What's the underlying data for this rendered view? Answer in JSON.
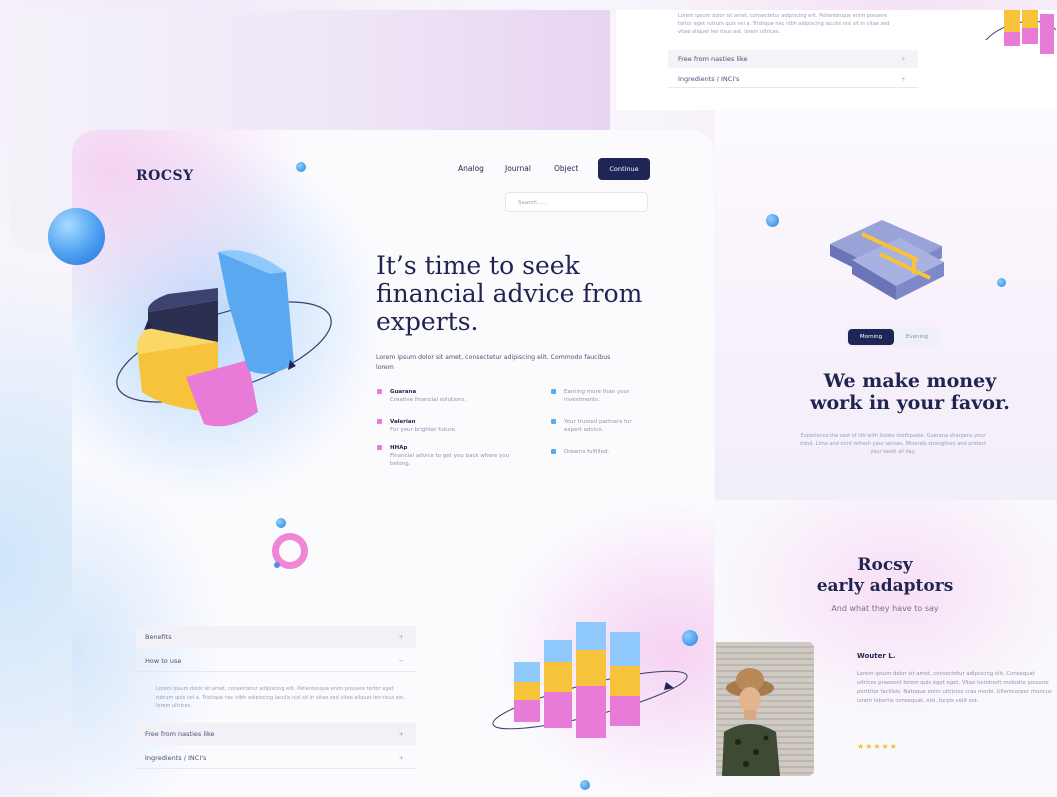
{
  "brand": {
    "logo": "ROCSY"
  },
  "nav": {
    "items": [
      "Analog",
      "Journal",
      "Object"
    ],
    "cta": "Continue"
  },
  "search": {
    "placeholder": "Search ....."
  },
  "hero": {
    "title": "It’s time to seek financial advice from experts.",
    "description": "Lorem ipsum dolor sit amet, consectetur adipiscing elit. Commodo faucibus lorem"
  },
  "features_left": [
    {
      "title": "Guarana",
      "text": "Creative financial solutions."
    },
    {
      "title": "Valerian",
      "text": "For your brighter future."
    },
    {
      "title": "HHAp",
      "text": "Financial advice to get you back where you belong."
    }
  ],
  "features_right": [
    {
      "text": "Earning more than your investments."
    },
    {
      "text": "Your trusted partners for expert advice."
    },
    {
      "text": "Dreams fulfilled."
    }
  ],
  "accordion": {
    "items": [
      {
        "label": "Benefits",
        "sign": "+"
      },
      {
        "label": "How to use",
        "sign": "−"
      },
      {
        "label": "Free from nasties like",
        "sign": "+"
      },
      {
        "label": "Ingredients / INCI's",
        "sign": "+"
      }
    ],
    "body": "Lorem ipsum dolor sit amet, consectetur adipiscing elit. Pellentesque enim posuere tortor eget rutrum quis vel a. Tristique nec nibh adipiscing iaculis nisl sit in vitae sed vitae aliquet leo risus est, lorem ultrices."
  },
  "right_top": {
    "paragraph": "Lorem ipsum dolor sit amet, consectetur adipiscing elit. Pellentesque enim posuere tortor eget rutrum quis vel a. Tristique nec nibh adipiscing iaculis nisl sit in vitae sed vitae aliquet leo risus est, lorem ultrices.",
    "rows": [
      {
        "label": "Free from nasties like",
        "sign": "+"
      },
      {
        "label": "Ingredients / INCI's",
        "sign": "+"
      }
    ]
  },
  "money": {
    "toggle": {
      "active": "Morning",
      "inactive": "Evening"
    },
    "title_line1": "We make money",
    "title_line2": "work in your favor.",
    "description": "Experience the zest of life with Xooko toothpaste. Guarana sharpens your mind. Lime and mint refresh your senses. Minerals strengthen and protect your teeth all day."
  },
  "adaptors": {
    "title_line1": "Rocsy",
    "title_line2": "early adaptors",
    "subtitle": "And what they have to say",
    "reviewer": "Wouter L.",
    "review": "Lorem ipsum dolor sit amet, consectetur adipiscing elit. Consequat ultrices praesent lorem quis eget eget. Vitae hendrerit molestie posuere porttitor facilisis. Natoque enim ultricies cras morbi. Ullamcorper rhoncus lorem lobortis consequat, nisi, turpis velit est.",
    "stars": "★★★★★"
  },
  "colors": {
    "navy": "#1f2657",
    "accent_pink": "#e87ad8",
    "accent_blue": "#5aa9f0",
    "accent_yellow": "#f6c33a",
    "star": "#f2c230"
  }
}
